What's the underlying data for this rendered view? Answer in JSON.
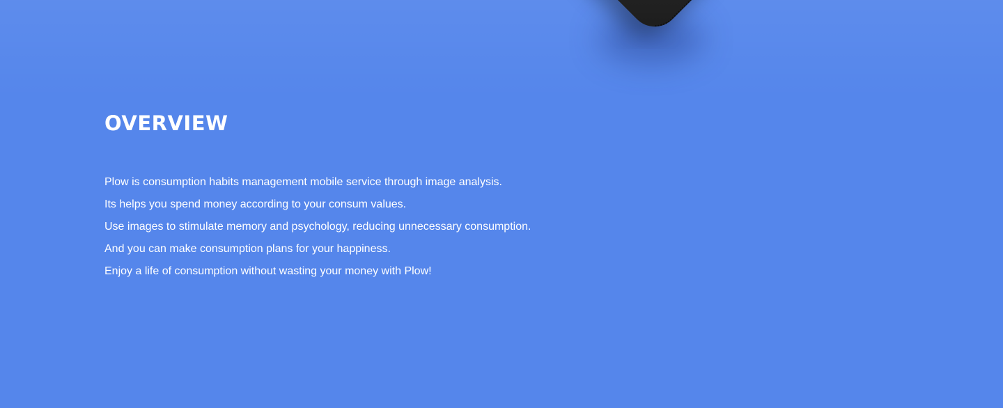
{
  "overview": {
    "title": "OVERVIEW",
    "lines": [
      "Plow is consumption habits management mobile service through image analysis.",
      "Its helps you spend money according to your consum values.",
      "Use images to stimulate memory and psychology, reducing unnecessary consumption.",
      "And you can make consumption plans for your happiness.",
      "Enjoy a life of consumption without wasting your money with Plow!"
    ]
  },
  "colors": {
    "background": "#5586EB",
    "text": "#ffffff",
    "device": "#262626"
  },
  "icons": {
    "device": "phone-mockup-icon"
  }
}
